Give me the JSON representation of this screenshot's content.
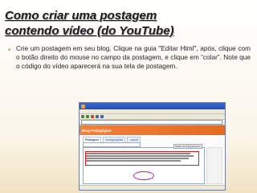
{
  "slide": {
    "title_line1": "Como criar uma postagem",
    "title_line2": "contendo vídeo (do YouTube)",
    "body": "Crie um postagem em seu blog. Clique na guia \"Editar Html\", após, clique com o botão direito do mouse no campo da postagem, e clique em “colar”. Note que o código do vídeo aparecerá na sua tela de postagem.",
    "bullet_glyph": "•"
  },
  "screenshot": {
    "blog_title": "Blog Pedagógico",
    "tabs": [
      "Postagem",
      "Configurações",
      "Layout"
    ],
    "active_tab": "Postagem",
    "mode_buttons": [
      "Editar Html",
      "Escrever"
    ]
  },
  "colors": {
    "bullet": "#c58a2e",
    "blog_header": "#e56b1f",
    "highlight_box": "#d02020",
    "highlight_oval": "#b020b0"
  }
}
